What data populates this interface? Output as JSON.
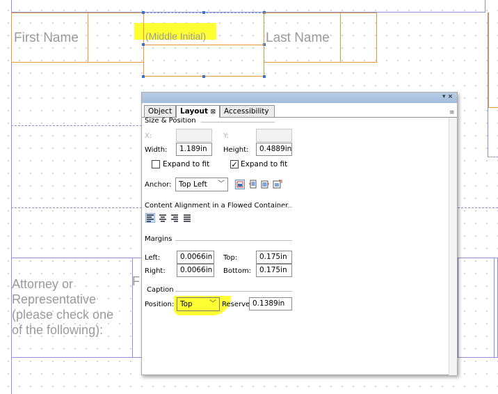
{
  "form": {
    "first_name": "First Name",
    "middle_initial": "(Middle Initial)",
    "last_name": "Last Name",
    "attorney_lines": [
      "Attorney or",
      "Representative",
      "(please check one",
      "of the following):"
    ],
    "f_fragment": "F"
  },
  "panel": {
    "window_controls": "▾ ×",
    "menu_glyph": "≡",
    "tabs": [
      {
        "label": "Object",
        "active": false
      },
      {
        "label": "Layout",
        "active": true,
        "close_glyph": "⊠"
      },
      {
        "label": "Accessibility",
        "active": false
      }
    ],
    "size_position": {
      "title": "Size & Position",
      "x_label": "X:",
      "x_value": "",
      "y_label": "Y:",
      "y_value": "",
      "width_label": "Width:",
      "width_value": "1.189in",
      "height_label": "Height:",
      "height_value": "0.4889in",
      "expand_width_label": "Expand to fit",
      "expand_width_checked": false,
      "expand_height_label": "Expand to fit",
      "expand_height_checked": true,
      "checkmark": "✓",
      "anchor_label": "Anchor:",
      "anchor_value": "Top Left",
      "dropdown_arrow": "﹀"
    },
    "content_alignment": {
      "title": "Content Alignment in a Flowed Container"
    },
    "margins": {
      "title": "Margins",
      "left_label": "Left:",
      "left_value": "0.0066in",
      "top_label": "Top:",
      "top_value": "0.175in",
      "right_label": "Right:",
      "right_value": "0.0066in",
      "bottom_label": "Bottom:",
      "bottom_value": "0.175in"
    },
    "caption": {
      "title": "Caption",
      "position_label": "Position:",
      "position_value": "Top",
      "reserve_label": "Reserve:",
      "reserve_value": "0.1389in"
    }
  },
  "colors": {
    "highlight": "#ffff00",
    "field_border": "#e8963a",
    "guide_line": "#8d8fd8",
    "selection_handle": "#3b73c8",
    "panel_title": "#a9c0de"
  }
}
